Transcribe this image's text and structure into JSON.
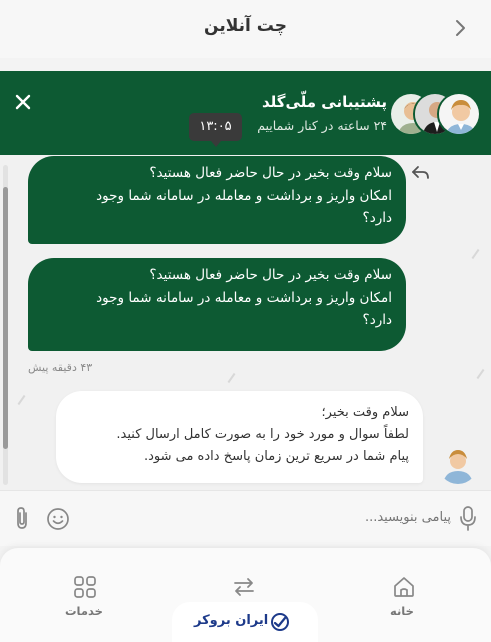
{
  "topbar": {
    "title": "چت آنلاین"
  },
  "header": {
    "name": "پشتیبانی ملّی‌گلد",
    "subtitle": "۲۴ ساعته در کنار شماییم",
    "tooltip": "۱۳:۰۵"
  },
  "messages": [
    {
      "lines": [
        "سلام وقت بخیر در حال حاضر  فعال هستید؟",
        "امکان واریز و برداشت و معامله در سامانه شما وجود",
        "دارد؟"
      ]
    },
    {
      "lines": [
        "سلام وقت بخیر در حال حاضر  فعال هستید؟",
        "امکان واریز و برداشت و معامله در سامانه شما وجود",
        "دارد؟"
      ]
    }
  ],
  "time_ago": "۴۳ دقیقه پیش",
  "agent_message": {
    "lines": [
      "سلام وقت بخیر؛",
      "لطفاً سوال و مورد خود را به صورت کامل ارسال کنید.",
      "پیام شما در سریع ترین زمان پاسخ داده می شود."
    ]
  },
  "composer": {
    "placeholder": "پیامی بنویسید..."
  },
  "nav": {
    "home": "خانه",
    "services": "خدمات",
    "brand": "ایران بروکر"
  },
  "colors": {
    "primary": "#0d5a33",
    "brand": "#1d3a8a"
  },
  "icons": [
    "back-chevron-icon",
    "close-icon",
    "reply-icon",
    "mic-icon",
    "emoji-icon",
    "attach-icon",
    "home-icon",
    "swap-icon",
    "services-grid-icon",
    "brand-logo-icon"
  ]
}
